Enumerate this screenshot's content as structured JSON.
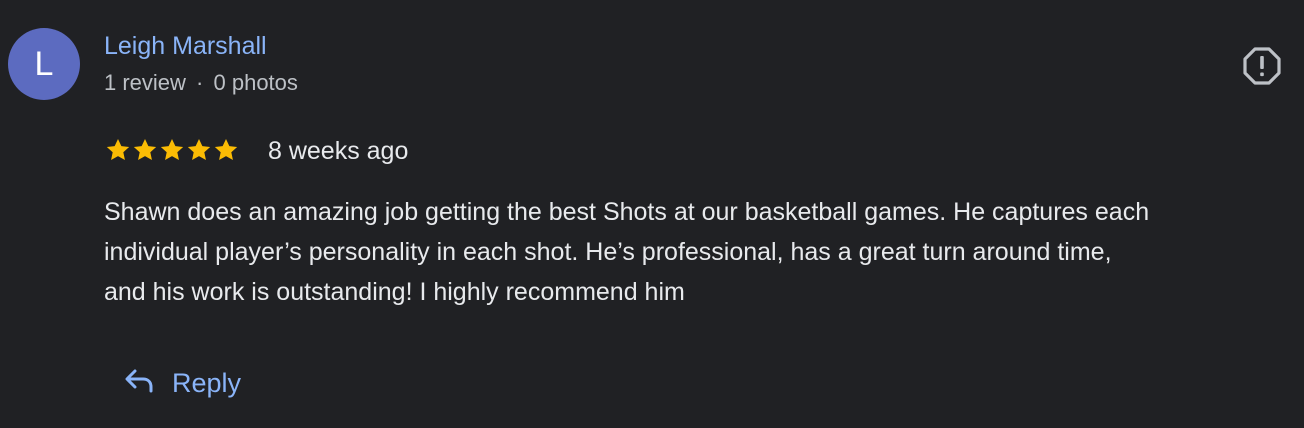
{
  "reviewer": {
    "initial": "L",
    "name": "Leigh Marshall",
    "review_count": "1 review",
    "separator": "·",
    "photo_count": "0 photos",
    "avatar_color": "#5c6bc0"
  },
  "review": {
    "rating": 5,
    "max_rating": 5,
    "star_color": "#fbbc04",
    "time_ago": "8 weeks ago",
    "text_lines": [
      "Shawn does an amazing job getting the best Shots at our basketball games. He captures each",
      "individual player’s personality in each shot. He’s professional, has a great turn around time,",
      "and his work is outstanding! I highly recommend him"
    ]
  },
  "actions": {
    "reply_label": "Reply",
    "flag_icon": "report-flag-icon"
  },
  "colors": {
    "background": "#202124",
    "link": "#8ab4f8",
    "text": "#e8eaed",
    "secondary_text": "#bdc1c6"
  }
}
